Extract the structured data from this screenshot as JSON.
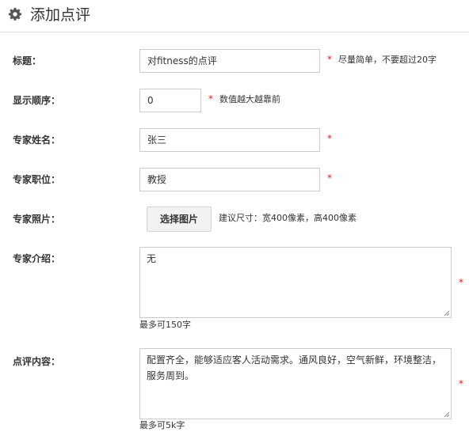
{
  "header": {
    "title": "添加点评",
    "icon": "gear-icon"
  },
  "form": {
    "title": {
      "label": "标题：",
      "value": "对fitness的点评",
      "required": "*",
      "hint": "尽量简单，不要超过20字"
    },
    "order": {
      "label": "显示顺序：",
      "value": "0",
      "required": "*",
      "hint": "数值越大越靠前"
    },
    "name": {
      "label": "专家姓名：",
      "value": "张三",
      "required": "*"
    },
    "position": {
      "label": "专家职位：",
      "value": "教授",
      "required": "*"
    },
    "photo": {
      "label": "专家照片：",
      "button": "选择图片",
      "hint": "建议尺寸：宽400像素，高400像素"
    },
    "intro": {
      "label": "专家介绍：",
      "value": "无",
      "required": "*",
      "hint": "最多可150字"
    },
    "content": {
      "label": "点评内容：",
      "value": "配置齐全，能够适应客人活动需求。通风良好，空气新鲜，环境整洁，服务周到。",
      "required": "*",
      "hint": "最多可5k字"
    }
  }
}
